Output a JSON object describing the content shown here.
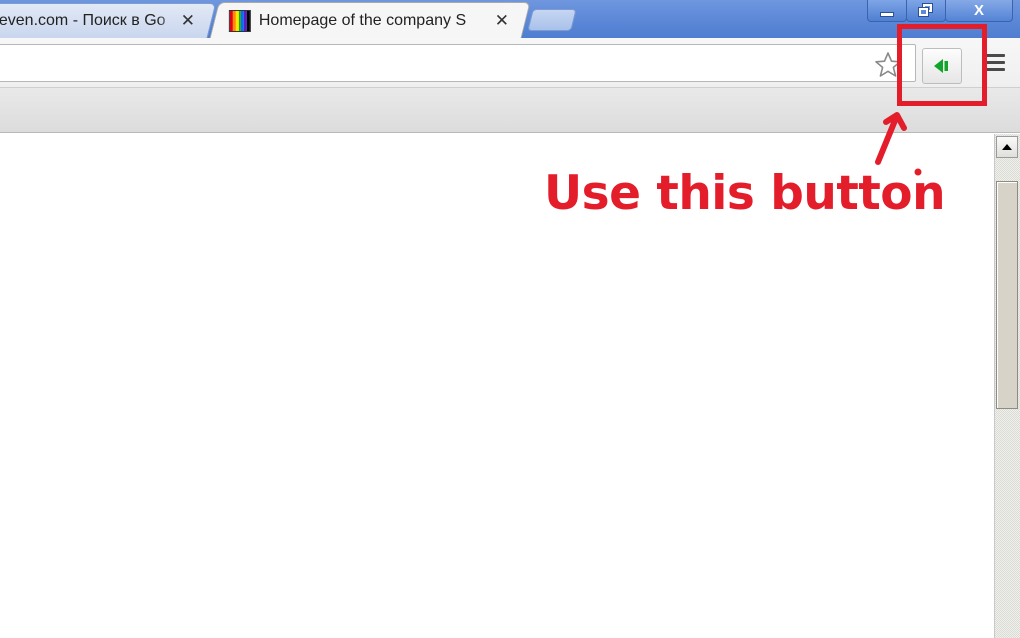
{
  "tabs": [
    {
      "title": "even.com - Поиск в Go",
      "active": false,
      "close_label": "✕"
    },
    {
      "title": "Homepage of the company S",
      "active": true,
      "close_label": "✕"
    }
  ],
  "window_controls": {
    "close_label": "X"
  },
  "toolbar": {
    "star_icon": "bookmark-star-icon",
    "extension_icon": "green-speaker-icon",
    "menu_icon": "hamburger-menu-icon"
  },
  "annotation": {
    "text": "Use this button",
    "color": "#e41d2b"
  },
  "colors": {
    "titlebar": "#5a86d6",
    "extension_green": "#12a52c"
  }
}
